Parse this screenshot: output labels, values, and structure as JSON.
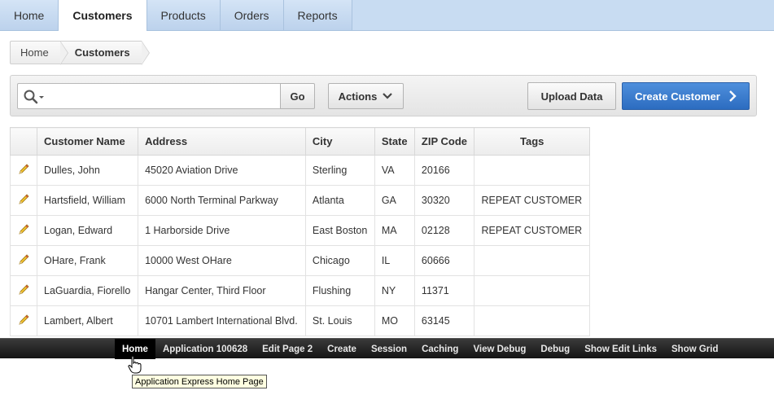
{
  "tabs": [
    {
      "label": "Home",
      "active": false
    },
    {
      "label": "Customers",
      "active": true
    },
    {
      "label": "Products",
      "active": false
    },
    {
      "label": "Orders",
      "active": false
    },
    {
      "label": "Reports",
      "active": false
    }
  ],
  "breadcrumb": [
    {
      "label": "Home"
    },
    {
      "label": "Customers"
    }
  ],
  "toolbar": {
    "search_value": "",
    "go_label": "Go",
    "actions_label": "Actions",
    "upload_label": "Upload Data",
    "create_label": "Create Customer"
  },
  "report": {
    "columns": [
      "Customer Name",
      "Address",
      "City",
      "State",
      "ZIP Code",
      "Tags"
    ],
    "rows": [
      [
        "Dulles, John",
        "45020 Aviation Drive",
        "Sterling",
        "VA",
        "20166",
        ""
      ],
      [
        "Hartsfield, William",
        "6000 North Terminal Parkway",
        "Atlanta",
        "GA",
        "30320",
        "REPEAT CUSTOMER"
      ],
      [
        "Logan, Edward",
        "1 Harborside Drive",
        "East Boston",
        "MA",
        "02128",
        "REPEAT CUSTOMER"
      ],
      [
        "OHare, Frank",
        "10000 West OHare",
        "Chicago",
        "IL",
        "60666",
        ""
      ],
      [
        "LaGuardia, Fiorello",
        "Hangar Center, Third Floor",
        "Flushing",
        "NY",
        "11371",
        ""
      ],
      [
        "Lambert, Albert",
        "10701 Lambert International Blvd.",
        "St. Louis",
        "MO",
        "63145",
        ""
      ]
    ]
  },
  "dev_toolbar": {
    "items": [
      "Home",
      "Application 100628",
      "Edit Page 2",
      "Create",
      "Session",
      "Caching",
      "View Debug",
      "Debug",
      "Show Edit Links",
      "Show Grid"
    ],
    "active_index": 0
  },
  "tooltip": "Application Express Home Page",
  "colors": {
    "tab_bar": "#c8dcf2",
    "create_button": "#3a7bd0",
    "dev_toolbar": "#1e1e1e"
  },
  "icons": {
    "search": "search-icon",
    "dropdown": "chevron-down-icon",
    "next": "chevron-right-icon",
    "edit": "pencil-icon",
    "cursor": "hand-cursor-icon"
  }
}
